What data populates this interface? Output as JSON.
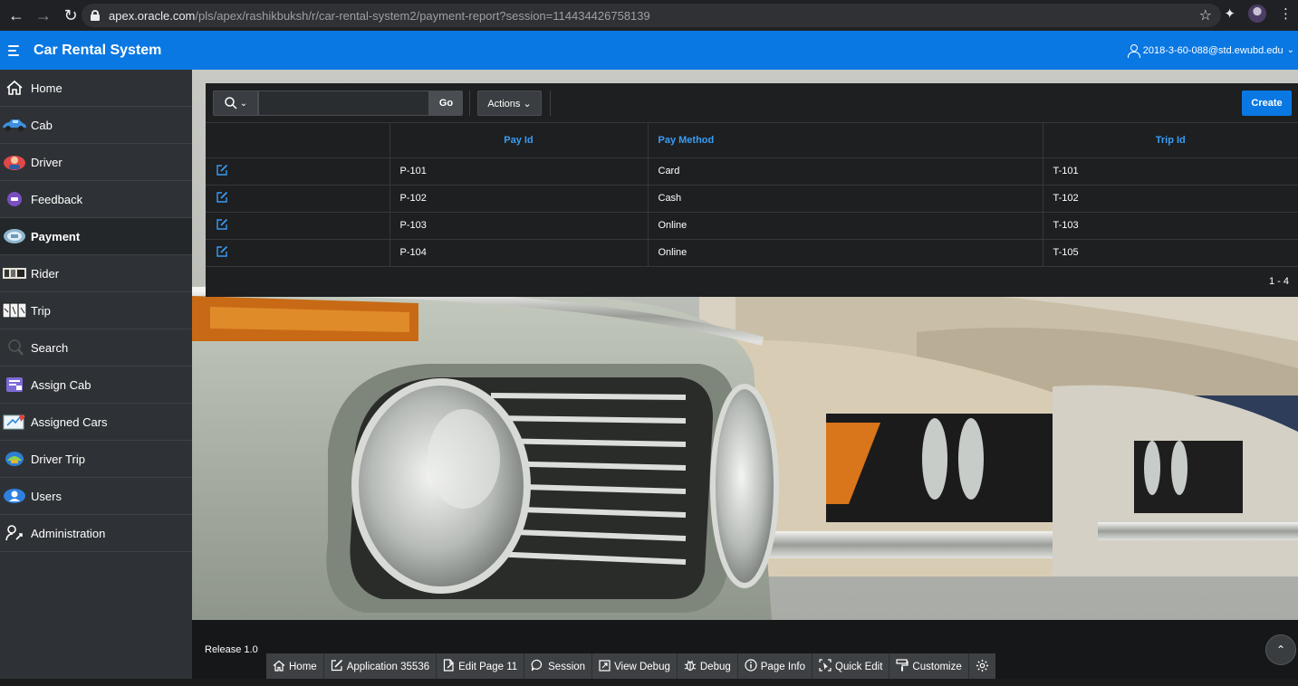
{
  "browser": {
    "url_host": "apex.oracle.com",
    "url_path": "/pls/apex/rashikbuksh/r/car-rental-system2/payment-report?session=114434426758139"
  },
  "header": {
    "app_title": "Car Rental System",
    "user": "2018-3-60-088@std.ewubd.edu"
  },
  "sidebar": {
    "items": [
      {
        "label": "Home",
        "icon": "home-icon"
      },
      {
        "label": "Cab",
        "icon": "cab-icon"
      },
      {
        "label": "Driver",
        "icon": "driver-icon"
      },
      {
        "label": "Feedback",
        "icon": "feedback-icon"
      },
      {
        "label": "Payment",
        "icon": "payment-icon",
        "active": true
      },
      {
        "label": "Rider",
        "icon": "rider-icon"
      },
      {
        "label": "Trip",
        "icon": "trip-icon"
      },
      {
        "label": "Search",
        "icon": "search-icon"
      },
      {
        "label": "Assign Cab",
        "icon": "assign-cab-icon"
      },
      {
        "label": "Assigned Cars",
        "icon": "assigned-cars-icon"
      },
      {
        "label": "Driver Trip",
        "icon": "driver-trip-icon"
      },
      {
        "label": "Users",
        "icon": "users-icon"
      },
      {
        "label": "Administration",
        "icon": "administration-icon"
      }
    ]
  },
  "report": {
    "search_placeholder": "",
    "go_label": "Go",
    "actions_label": "Actions",
    "create_label": "Create",
    "columns": [
      "",
      "Pay Id",
      "Pay Method",
      "Trip Id"
    ],
    "rows": [
      {
        "pay_id": "P-101",
        "pay_method": "Card",
        "trip_id": "T-101"
      },
      {
        "pay_id": "P-102",
        "pay_method": "Cash",
        "trip_id": "T-102"
      },
      {
        "pay_id": "P-103",
        "pay_method": "Online",
        "trip_id": "T-103"
      },
      {
        "pay_id": "P-104",
        "pay_method": "Online",
        "trip_id": "T-105"
      }
    ],
    "pagination": "1 - 4"
  },
  "footer": {
    "release": "Release 1.0",
    "dev_toolbar": [
      {
        "label": "Home",
        "icon": "home-icon"
      },
      {
        "label": "Application 35536",
        "icon": "pencil-icon"
      },
      {
        "label": "Edit Page 11",
        "icon": "edit-page-icon"
      },
      {
        "label": "Session",
        "icon": "session-icon"
      },
      {
        "label": "View Debug",
        "icon": "view-debug-icon"
      },
      {
        "label": "Debug",
        "icon": "bug-icon"
      },
      {
        "label": "Page Info",
        "icon": "info-icon"
      },
      {
        "label": "Quick Edit",
        "icon": "quick-edit-icon"
      },
      {
        "label": "Customize",
        "icon": "paint-roller-icon"
      },
      {
        "label": "",
        "icon": "gear-icon"
      }
    ]
  },
  "colors": {
    "header_blue": "#0a78e2",
    "sidebar_bg": "#2e3236",
    "report_bg": "#1d1f21",
    "link_blue": "#3a9cf5"
  }
}
